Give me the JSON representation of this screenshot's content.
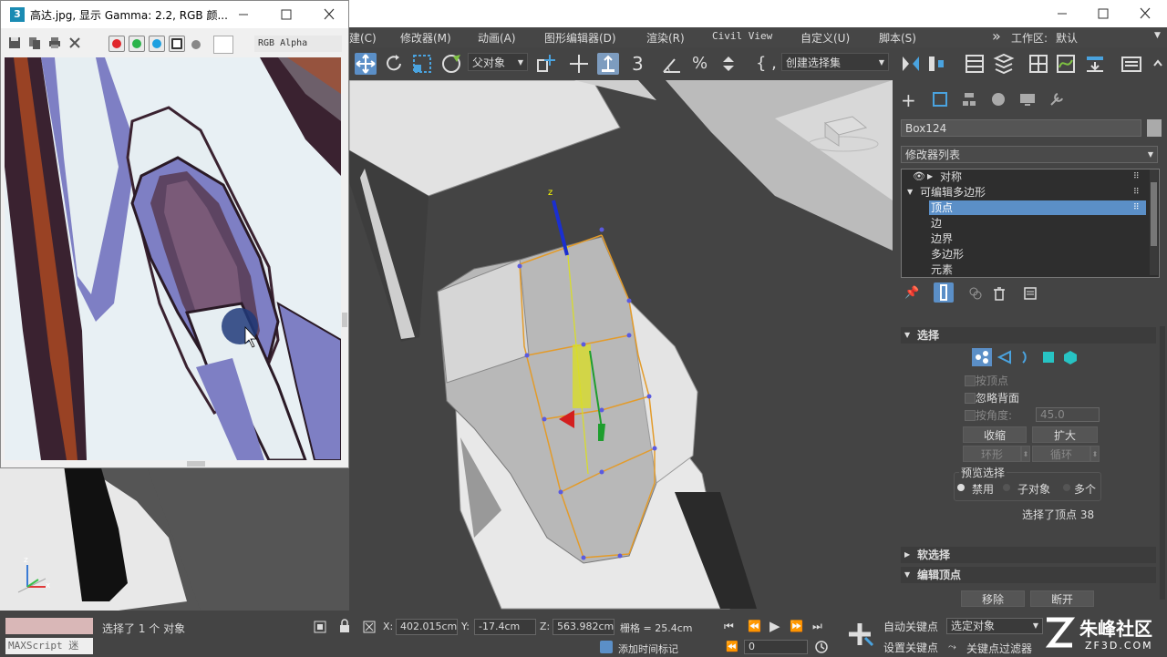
{
  "max_window": {
    "workspace_label": "工作区:",
    "workspace_value": "默认",
    "menus": [
      "建(C)",
      "修改器(M)",
      "动画(A)",
      "图形编辑器(D)",
      "渲染(R)",
      "Civil View",
      "自定义(U)",
      "脚本(S)"
    ],
    "menu_overflow": "»"
  },
  "toolbar": {
    "ref_coord": "父对象",
    "named_selection": "创建选择集",
    "snap_number": "3"
  },
  "viewport": {
    "axis_z": "z"
  },
  "left_viewport": {
    "axis_z": "z",
    "axis_x": "x"
  },
  "command_panel": {
    "object_name": "Box124",
    "modifier_list": "修改器列表",
    "stack": [
      {
        "label": "对称",
        "indent": 1,
        "selected": false
      },
      {
        "label": "可编辑多边形",
        "indent": 0,
        "selected": false
      },
      {
        "label": "顶点",
        "indent": 2,
        "selected": true
      },
      {
        "label": "边",
        "indent": 2,
        "selected": false
      },
      {
        "label": "边界",
        "indent": 2,
        "selected": false
      },
      {
        "label": "多边形",
        "indent": 2,
        "selected": false
      },
      {
        "label": "元素",
        "indent": 2,
        "selected": false
      }
    ],
    "selection_rollout": "选择",
    "by_vertex": "按顶点",
    "ignore_backfacing": "忽略背面",
    "by_angle": "按角度:",
    "angle_value": "45.0",
    "shrink": "收缩",
    "grow": "扩大",
    "ring": "环形",
    "loop": "循环",
    "preview_selection": "预览选择",
    "disable": "禁用",
    "subobject": "子对象",
    "multi": "多个",
    "selected_info": "选择了顶点 38",
    "soft_selection": "软选择",
    "edit_vertices": "编辑顶点",
    "remove": "移除",
    "break": "断开"
  },
  "status_bar": {
    "maxscript": "MAXScript 迷",
    "selected_text": "选择了 1 个 对象",
    "x_label": "X:",
    "x_value": "402.015cm",
    "y_label": "Y:",
    "y_value": "-17.4cm",
    "z_label": "Z:",
    "z_value": "563.982cm",
    "grid": "栅格 = 25.4cm",
    "add_time_tag": "添加时间标记",
    "auto_key": "自动关键点",
    "set_key": "设置关键点",
    "selected_object": "选定对象",
    "key_filters": "关键点过滤器",
    "frame": "0",
    "watermark": "朱峰社区",
    "watermark_url": "ZF3D.COM"
  },
  "image_viewer": {
    "title": "高达.jpg, 显示 Gamma: 2.2, RGB 颜...",
    "channel": "RGB Alpha",
    "channel_colors": [
      "#e0262b",
      "#2bb34a",
      "#1ea0e0"
    ]
  }
}
